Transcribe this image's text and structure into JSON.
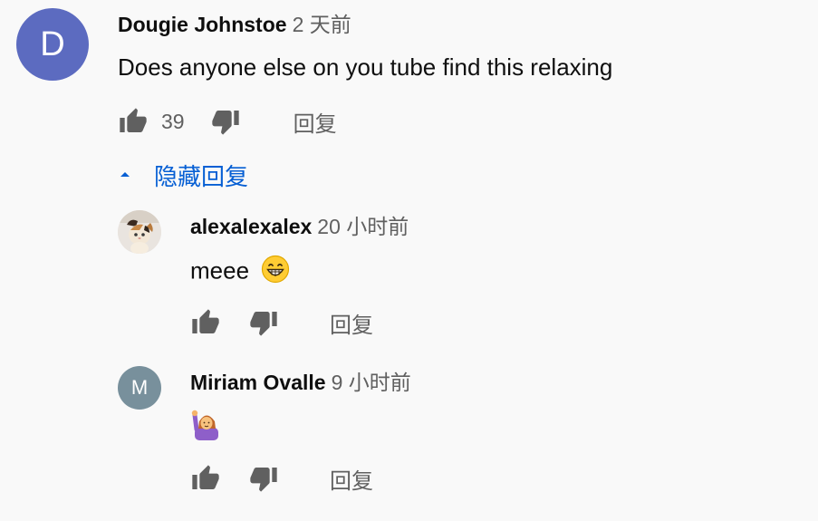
{
  "comment": {
    "avatar_letter": "D",
    "avatar_color": "#5c6bc0",
    "author": "Dougie Johnstoe",
    "time": "2 天前",
    "text": "Does anyone else on you tube find this relaxing",
    "likes": "39",
    "reply_label": "回复"
  },
  "hide_replies_label": "隐藏回复",
  "replies": [
    {
      "author": "alexalexalex",
      "time": "20 小时前",
      "text": "meee",
      "emoji": "grinning-face",
      "reply_label": "回复"
    },
    {
      "avatar_letter": "M",
      "avatar_color": "#78909c",
      "author": "Miriam Ovalle",
      "time": "9 小时前",
      "emoji": "person-raising-hand",
      "reply_label": "回复"
    }
  ],
  "colors": {
    "background": "#f9f9f9",
    "link_blue": "#065fd4",
    "secondary_text": "#606060"
  }
}
